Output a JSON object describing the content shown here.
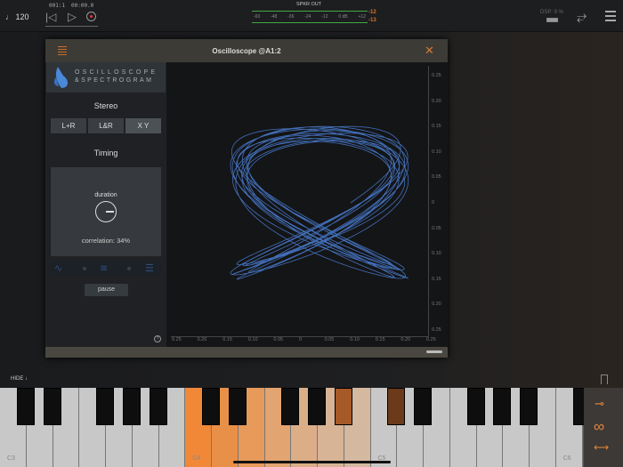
{
  "topbar": {
    "tempo": "♩ 120",
    "position": "001:1",
    "time": "00:00.0",
    "meter_title": "SPKR OUT",
    "meter_scale": [
      "-60",
      "-48",
      "-36",
      "-24",
      "-12",
      "0 dB",
      "+12"
    ],
    "peak_l": "-12",
    "peak_r": "-13",
    "dsp": "DSP: 9 %"
  },
  "window": {
    "title": "Oscilloscope @A1:2",
    "logo_line1": "OSCILLOSCOPE",
    "logo_line2": "&SPECTROGRAM",
    "stereo_label": "Stereo",
    "modes": [
      "L+R",
      "L&R",
      "X Y"
    ],
    "selected_mode": "X Y",
    "timing_label": "Timing",
    "knob_label": "duration",
    "correlation": "correlation: 34%",
    "pause": "pause",
    "help": "?",
    "y_ticks": [
      "0.25",
      "0.20",
      "0.15",
      "0.10",
      "0.05",
      "0",
      "0.05",
      "0.10",
      "0.15",
      "0.20",
      "0.25"
    ],
    "x_ticks": [
      "0.25",
      "0.20",
      "0.15",
      "0.10",
      "0.05",
      "0",
      "0.05",
      "0.10",
      "0.15",
      "0.20",
      "0.25"
    ]
  },
  "keyboard": {
    "hide": "HIDE ↓",
    "labels": [
      "C3",
      "C4",
      "C5",
      "C6"
    ]
  },
  "colors": {
    "accent": "#e8863a",
    "trace": "#4a7fd6"
  }
}
